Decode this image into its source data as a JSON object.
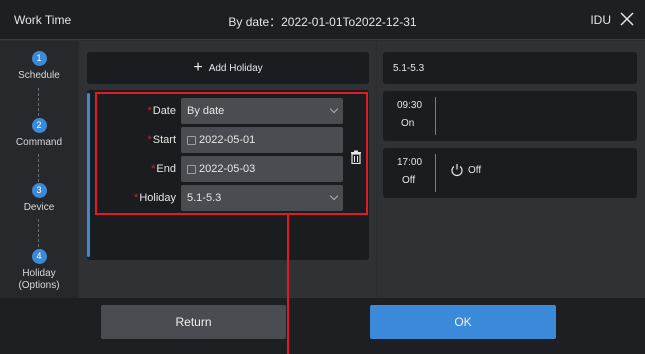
{
  "header": {
    "title": "Work Time",
    "date_range": "By date：2022-01-01To2022-12-31",
    "device": "IDU",
    "close_icon": "close-icon"
  },
  "steps": [
    {
      "num": "1",
      "label": "Schedule"
    },
    {
      "num": "2",
      "label": "Command"
    },
    {
      "num": "3",
      "label": "Device"
    },
    {
      "num": "4",
      "label": "Holiday\n(Options)"
    }
  ],
  "middle": {
    "add_holiday_label": "Add Holiday",
    "form": {
      "date": {
        "label": "Date",
        "value": "By date"
      },
      "start": {
        "label": "Start",
        "value": "2022-05-01"
      },
      "end": {
        "label": "End",
        "value": "2022-05-03"
      },
      "holiday": {
        "label": "Holiday",
        "value": "5.1-5.3"
      }
    }
  },
  "right": {
    "holiday_name": "5.1-5.3",
    "events": [
      {
        "time": "09:30",
        "action": "On",
        "command": ""
      },
      {
        "time": "17:00",
        "action": "Off",
        "command": "Off"
      }
    ]
  },
  "footer": {
    "return_label": "Return",
    "ok_label": "OK"
  },
  "colors": {
    "accent": "#3b8ad9",
    "highlight": "#e01b24",
    "required": "#e01b24"
  }
}
